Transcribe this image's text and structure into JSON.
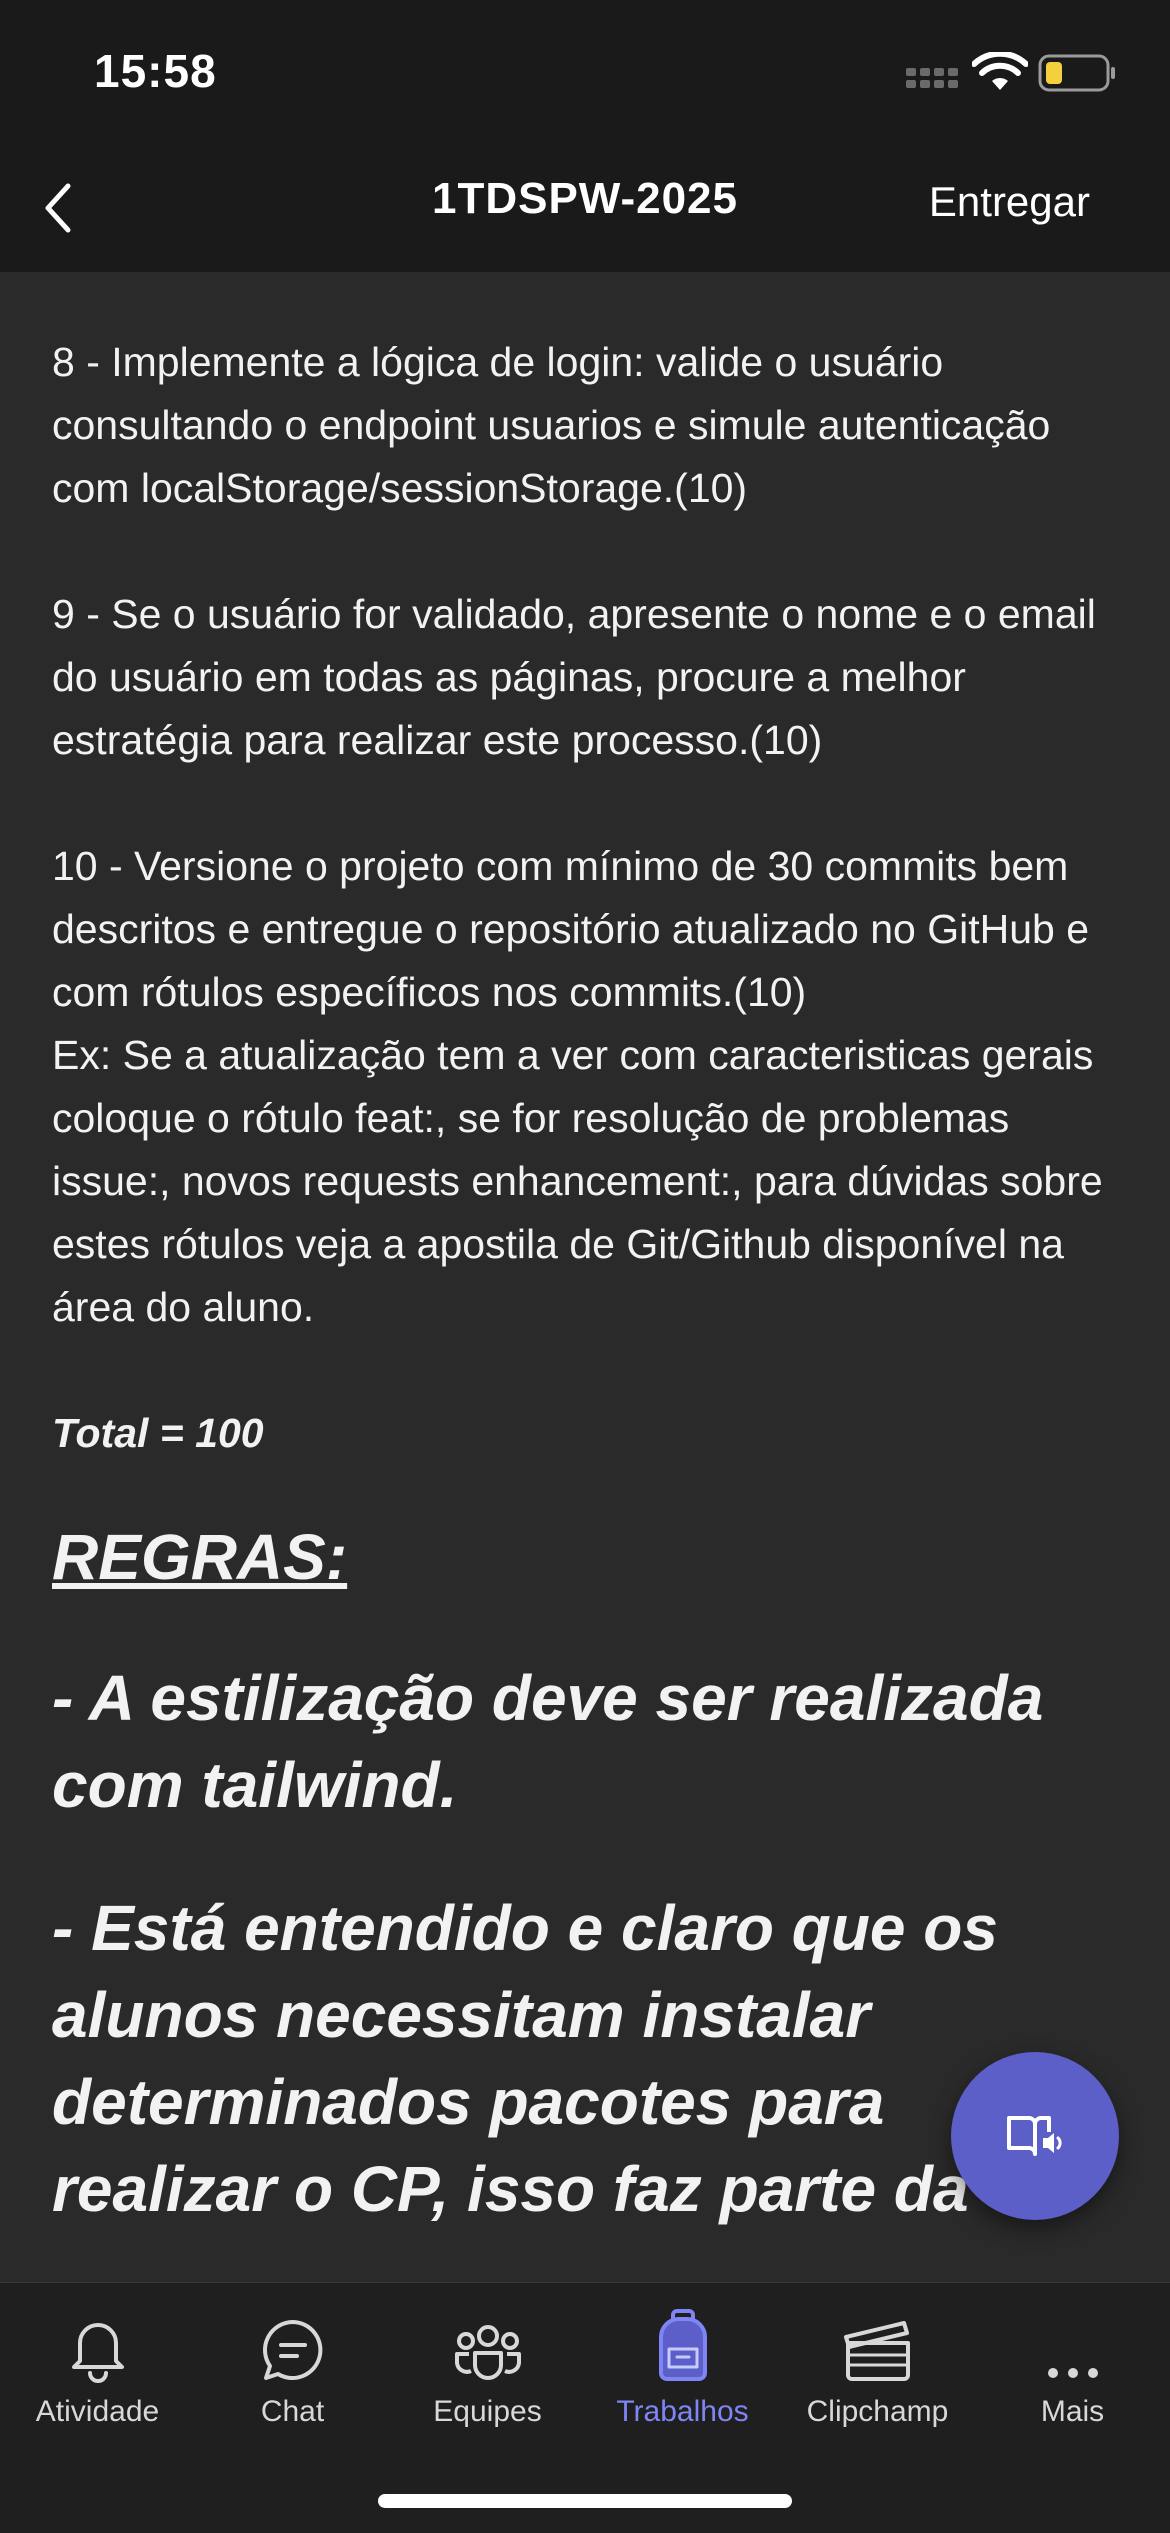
{
  "status": {
    "time": "15:58"
  },
  "nav": {
    "title": "1TDSPW-2025",
    "submit_label": "Entregar"
  },
  "content": {
    "item8": "8 - Implemente a lógica de login: valide o usuário consultando o endpoint usuarios e simule autenticação com localStorage/sessionStorage.(10)",
    "item9": "9 - Se o usuário for validado, apresente o nome  e o email  do usuário em todas as páginas, procure a melhor estratégia para realizar este processo.(10)",
    "item10": "10 - Versione o projeto com mínimo de 30 commits bem descritos e entregue o repositório atualizado no GitHub e com rótulos específicos nos commits.(10)",
    "example": "Ex: Se a atualização tem a ver com caracteristicas gerais coloque o rótulo feat:, se for resolução de problemas issue:, novos requests enhancement:, para dúvidas sobre estes rótulos veja a apostila de Git/Github disponível na área do aluno.",
    "total": "Total = 100",
    "rules_heading": "REGRAS:",
    "rule1": "- A estilização deve ser realizada com tailwind.",
    "rule2": "- Está entendido e claro que os alunos necessitam instalar determinados pacotes para realizar o CP, isso faz parte da"
  },
  "fab": {
    "icon": "immersive-reader-icon"
  },
  "tabs": [
    {
      "label": "Atividade",
      "icon": "bell-icon"
    },
    {
      "label": "Chat",
      "icon": "chat-icon"
    },
    {
      "label": "Equipes",
      "icon": "teams-icon"
    },
    {
      "label": "Trabalhos",
      "icon": "backpack-icon",
      "active": true
    },
    {
      "label": "Clipchamp",
      "icon": "clipchamp-icon"
    },
    {
      "label": "Mais",
      "icon": "more-icon"
    }
  ],
  "colors": {
    "accent": "#5b5fc7",
    "active_tab": "#7f85f5",
    "background": "#2a2a2b",
    "bar": "#1a1a1a"
  }
}
